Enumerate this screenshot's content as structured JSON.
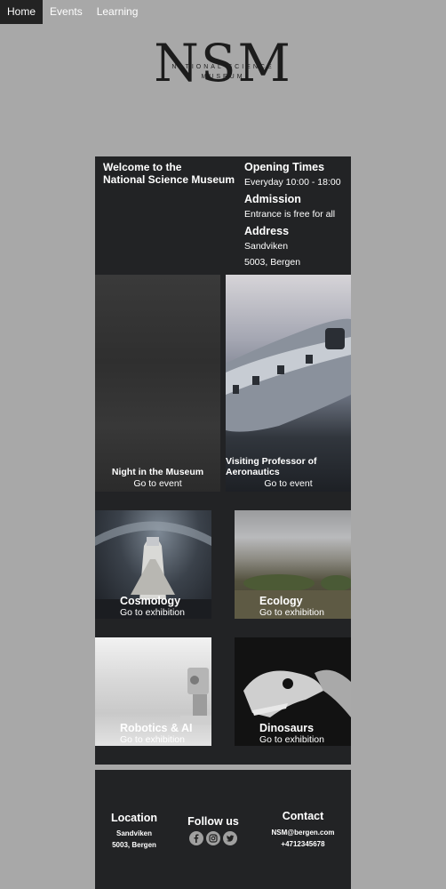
{
  "nav": {
    "items": [
      {
        "label": "Home",
        "active": true
      },
      {
        "label": "Events",
        "active": false
      },
      {
        "label": "Learning",
        "active": false
      }
    ]
  },
  "logo": {
    "letters": "NSM",
    "line1": "NATIONAL SCIENCE",
    "line2": "MUSEUM"
  },
  "welcome": {
    "line1": "Welcome to the",
    "line2": "National Science Museum"
  },
  "info": {
    "opening_title": "Opening Times",
    "opening_value": "Everyday 10:00 - 18:00",
    "admission_title": "Admission",
    "admission_value": "Entrance is free for all",
    "address_title": "Address",
    "address_line1": "Sandviken",
    "address_line2": "5003, Bergen"
  },
  "events": [
    {
      "title": "Night in the Museum",
      "link": "Go to event"
    },
    {
      "title": "Visiting Professor of Aeronautics",
      "link": "Go to event"
    }
  ],
  "exhibitions": [
    {
      "title": "Cosmology",
      "link": "Go to exhibition"
    },
    {
      "title": "Ecology",
      "link": "Go to exhibition"
    },
    {
      "title": "Robotics & AI",
      "link": "Go to exhibition"
    },
    {
      "title": "Dinosaurs",
      "link": "Go to exhibition"
    }
  ],
  "footer": {
    "location_title": "Location",
    "location_line1": "Sandviken",
    "location_line2": "5003, Bergen",
    "follow_title": "Follow us",
    "social_icons": [
      "facebook-icon",
      "instagram-icon",
      "twitter-icon"
    ],
    "contact_title": "Contact",
    "contact_email": "NSM@bergen.com",
    "contact_phone": "+4712345678"
  },
  "colors": {
    "page_bg": "#a8a8a8",
    "panel_bg": "#222325",
    "nav_active": "#232323",
    "text": "#ffffff"
  }
}
